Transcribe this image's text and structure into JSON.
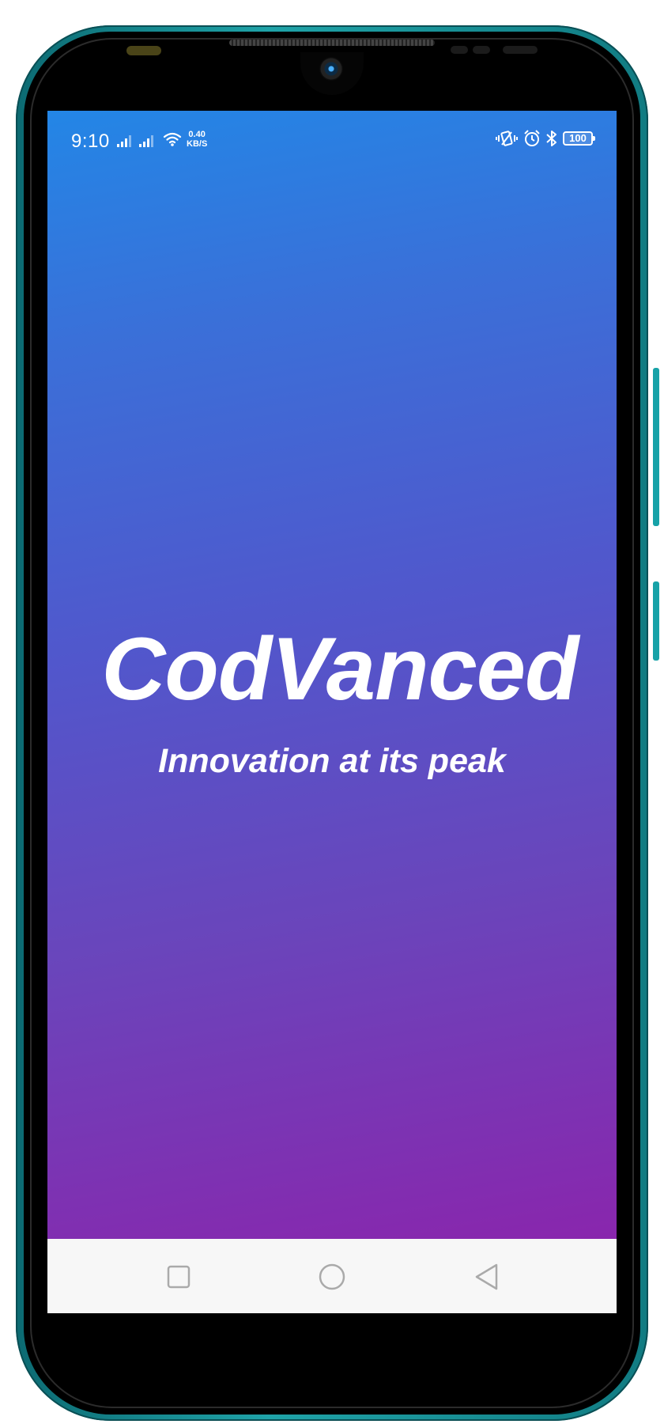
{
  "status_bar": {
    "time": "9:10",
    "net_speed_value": "0.40",
    "net_speed_unit": "KB/S",
    "battery_level": "100",
    "icons": [
      "signal-icon",
      "signal-icon",
      "wifi-icon",
      "vibrate-icon",
      "alarm-icon",
      "bluetooth-icon",
      "battery-icon"
    ]
  },
  "splash": {
    "app_name": "CodVanced",
    "tagline": "Innovation at its peak",
    "gradient_colors": [
      "#2386e6",
      "#5157cc",
      "#8926ad"
    ]
  },
  "nav_bar": {
    "buttons": [
      "recent-apps-button",
      "home-button",
      "back-button"
    ]
  },
  "device": {
    "frame_color": "#1fa3a8"
  }
}
